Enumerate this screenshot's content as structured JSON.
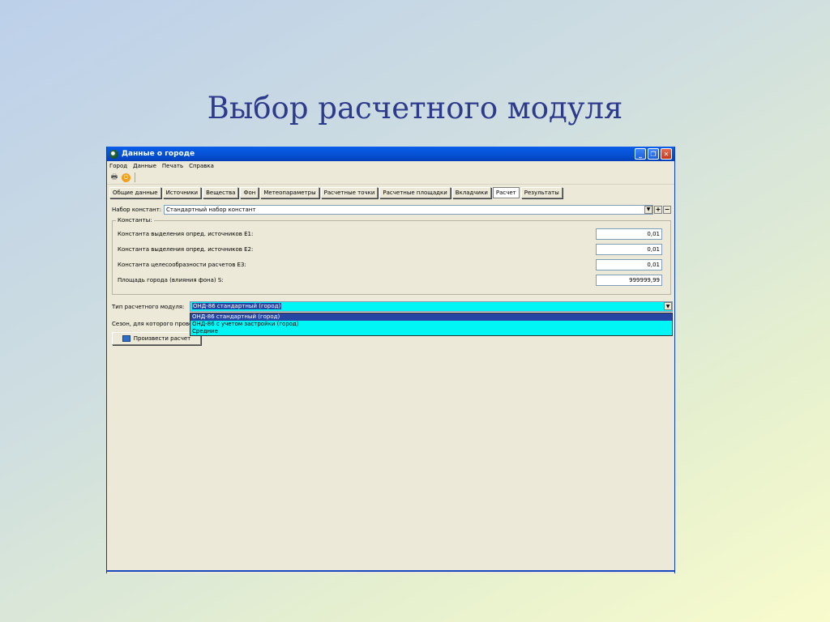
{
  "slide": {
    "title": "Выбор расчетного модуля"
  },
  "window": {
    "title": "Данные о городе",
    "controls": {
      "minimize": "_",
      "restore": "❐",
      "close": "✕"
    }
  },
  "menu": [
    "Город",
    "Данные",
    "Печать",
    "Справка"
  ],
  "toolbar": {
    "icons": [
      "printer-icon",
      "exit-icon"
    ]
  },
  "tabs": [
    {
      "label": "Общие данные",
      "active": false
    },
    {
      "label": "Источники",
      "active": false
    },
    {
      "label": "Вещества",
      "active": false
    },
    {
      "label": "Фон",
      "active": false
    },
    {
      "label": "Метеопараметры",
      "active": false
    },
    {
      "label": "Расчетные точки",
      "active": false
    },
    {
      "label": "Расчетные площадки",
      "active": false
    },
    {
      "label": "Вкладчики",
      "active": false
    },
    {
      "label": "Расчет",
      "active": true
    },
    {
      "label": "Результаты",
      "active": false
    }
  ],
  "constants_set": {
    "label": "Набор констант:",
    "value": "Стандартный набор констант",
    "add": "+",
    "remove": "−"
  },
  "constants": {
    "title": "Константы:",
    "rows": [
      {
        "label": "Константа выделения опред. источников Е1:",
        "value": "0,01"
      },
      {
        "label": "Константа выделения опред. источников Е2:",
        "value": "0,01"
      },
      {
        "label": "Константа целесообразности расчетов Е3:",
        "value": "0,01"
      },
      {
        "label": "Площадь города (влияния фона) S:",
        "value": "999999,99"
      }
    ]
  },
  "module": {
    "label": "Тип расчетного модуля:",
    "value": "ОНД-86 стандартный (город)",
    "options": [
      {
        "label": "ОНД-86 стандартный (город)",
        "selected": true
      },
      {
        "label": "ОНД-86 с учетом застройки (город)",
        "selected": false
      },
      {
        "label": "Средние",
        "selected": false
      }
    ]
  },
  "season": {
    "label": "Сезон, для которого провод"
  },
  "calc_button": {
    "label": "Произвести расчет"
  }
}
